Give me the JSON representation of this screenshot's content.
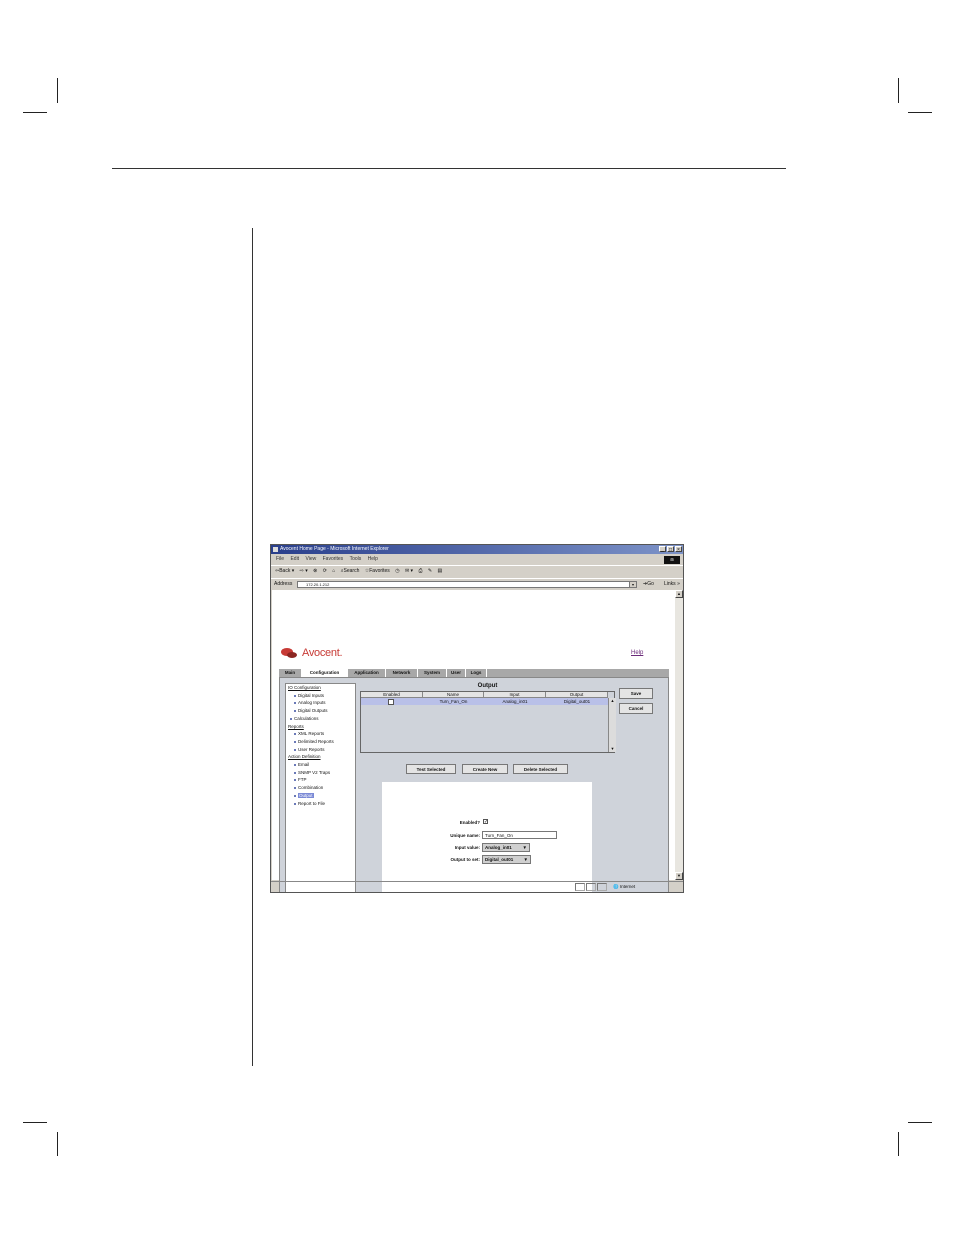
{
  "browser": {
    "title": "Avocent Home Page - Microsoft Internet Explorer",
    "menu": [
      "File",
      "Edit",
      "View",
      "Favorites",
      "Tools",
      "Help"
    ],
    "toolbar": {
      "back": "Back",
      "search": "Search",
      "favorites": "Favorites"
    },
    "address_label": "Address",
    "address_value": "172.20.1.212",
    "go_label": "Go",
    "links_label": "Links",
    "status_zone": "Internet"
  },
  "page": {
    "logo_text": "Avocent.",
    "help_link": "Help",
    "tabs": [
      {
        "label": "Main",
        "active": false
      },
      {
        "label": "Configuration",
        "active": true
      },
      {
        "label": "Application",
        "active": false
      },
      {
        "label": "Network",
        "active": false
      },
      {
        "label": "System",
        "active": false
      },
      {
        "label": "User",
        "active": false
      },
      {
        "label": "Logs",
        "active": false
      }
    ]
  },
  "tree": {
    "io_header": "IO Configuration",
    "io_items": [
      "Digital Inputs",
      "Analog Inputs",
      "Digital Outputs"
    ],
    "calculations": "Calculations",
    "reports_header": "Reports",
    "reports_items": [
      "XML Reports",
      "Delimited Reports",
      "User Reports"
    ],
    "action_header": "Action Definition",
    "action_items": [
      "Email",
      "SNMP V2 Traps",
      "FTP",
      "Combination",
      "Output",
      "Report to File"
    ],
    "selected": "Output"
  },
  "grid": {
    "title": "Output",
    "columns": [
      "Enabled",
      "Name",
      "Input",
      "Output"
    ],
    "rows": [
      {
        "enabled": false,
        "name": "Turn_Fan_On",
        "input": "Analog_in01",
        "output": "Digital_out01"
      }
    ]
  },
  "side_buttons": {
    "save": "Save",
    "cancel": "Cancel"
  },
  "actions": {
    "test": "Test Selected",
    "create": "Create New",
    "delete": "Delete Selected"
  },
  "form": {
    "enabled_label": "Enabled?",
    "enabled_checked": true,
    "name_label": "Unique name:",
    "name_value": "Turn_Fan_On",
    "input_label": "Input value:",
    "input_value": "Analog_in01",
    "output_label": "Output to set:",
    "output_value": "Digital_out01"
  }
}
